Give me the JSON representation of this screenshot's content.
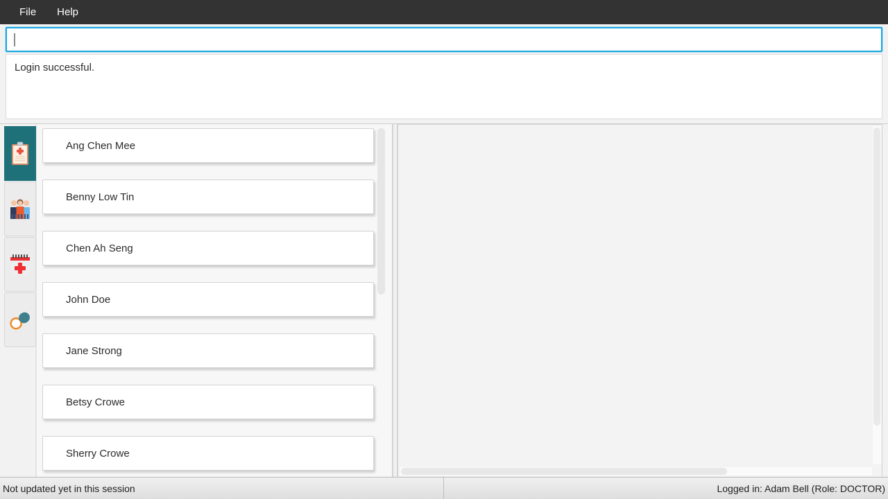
{
  "menubar": {
    "items": [
      {
        "label": "File",
        "name": "menu-file"
      },
      {
        "label": "Help",
        "name": "menu-help"
      }
    ]
  },
  "command": {
    "value": "",
    "placeholder": "",
    "focused": true
  },
  "result": {
    "message": "Login successful."
  },
  "sidebar": {
    "tabs": [
      {
        "icon": "clipboard-record-icon",
        "label": "Records",
        "active": true
      },
      {
        "icon": "patients-people-icon",
        "label": "Patients",
        "active": false
      },
      {
        "icon": "appointment-calendar-icon",
        "label": "Appointments",
        "active": false
      },
      {
        "icon": "medication-pill-icon",
        "label": "Medications",
        "active": false
      }
    ]
  },
  "patient_list": {
    "items": [
      {
        "name": "Ang Chen Mee"
      },
      {
        "name": "Benny Low Tin"
      },
      {
        "name": "Chen Ah Seng"
      },
      {
        "name": "John Doe"
      },
      {
        "name": "Jane Strong"
      },
      {
        "name": "Betsy Crowe"
      },
      {
        "name": "Sherry Crowe"
      }
    ]
  },
  "detail": {
    "content": ""
  },
  "statusbar": {
    "left": "Not updated yet in this session",
    "right": "Logged in: Adam Bell (Role: DOCTOR)"
  },
  "colors": {
    "menubar_bg": "#333333",
    "accent_focus": "#19a7e0",
    "active_tab_bg": "#1e7179",
    "card_bg": "#ffffff",
    "app_bg": "#f2f2f2"
  }
}
